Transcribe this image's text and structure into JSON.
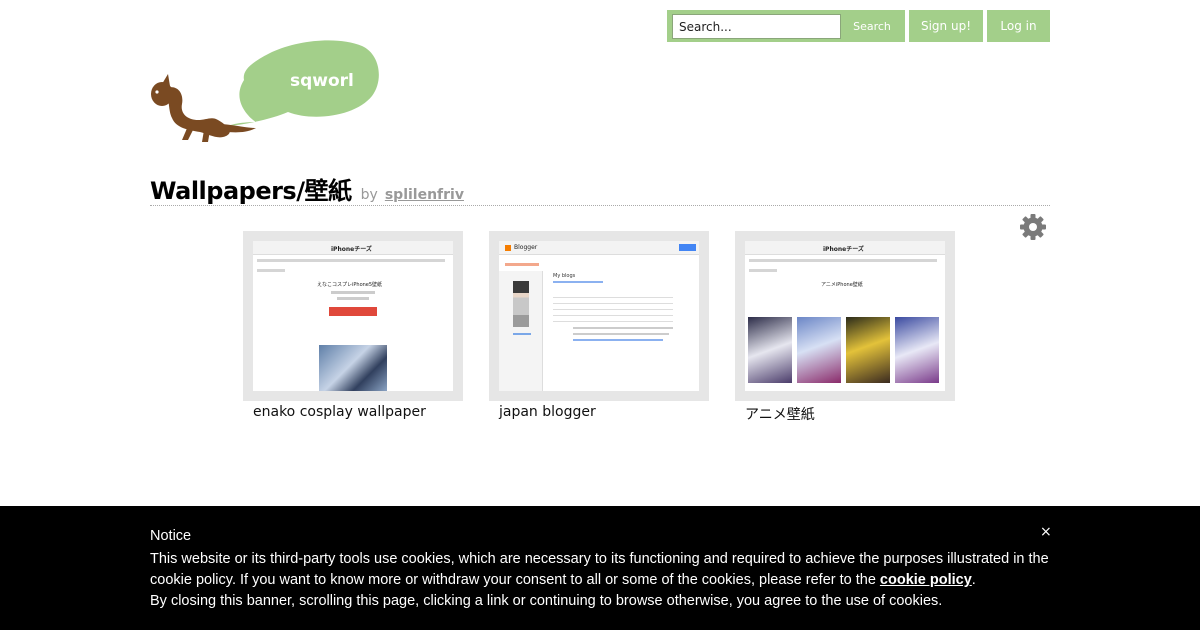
{
  "header": {
    "search_placeholder": "Search...",
    "search_button": "Search",
    "signup_button": "Sign up!",
    "login_button": "Log in"
  },
  "logo": {
    "text": "sqworl"
  },
  "page": {
    "title": "Wallpapers/壁紙",
    "by_label": "by",
    "author": "splilenfriv"
  },
  "cards": [
    {
      "label": "enako cosplay wallpaper",
      "site": "iPhoneチーズ",
      "heading": "えなこコスプレiPhone5壁紙"
    },
    {
      "label": "japan blogger",
      "site": "Blogger",
      "heading": "My blogs"
    },
    {
      "label": "アニメ壁紙",
      "site": "iPhoneチーズ",
      "heading": "アニメiPhone壁紙"
    }
  ],
  "cookie": {
    "title": "Notice",
    "text_1": "This website or its third-party tools use cookies, which are necessary to its functioning and required to achieve the purposes illustrated in the cookie policy. If you want to know more or withdraw your consent to all or some of the cookies, please refer to the ",
    "policy_link": "cookie policy",
    "text_2": ".",
    "text_3": "By closing this banner, scrolling this page, clicking a link or continuing to browse otherwise, you agree to the use of cookies.",
    "close": "×"
  },
  "colors": {
    "accent": "#a3cf8a",
    "logo_brown": "#7a4a22",
    "banner": "#000000"
  },
  "icons": {
    "settings": "gear-icon",
    "close": "close-icon"
  }
}
